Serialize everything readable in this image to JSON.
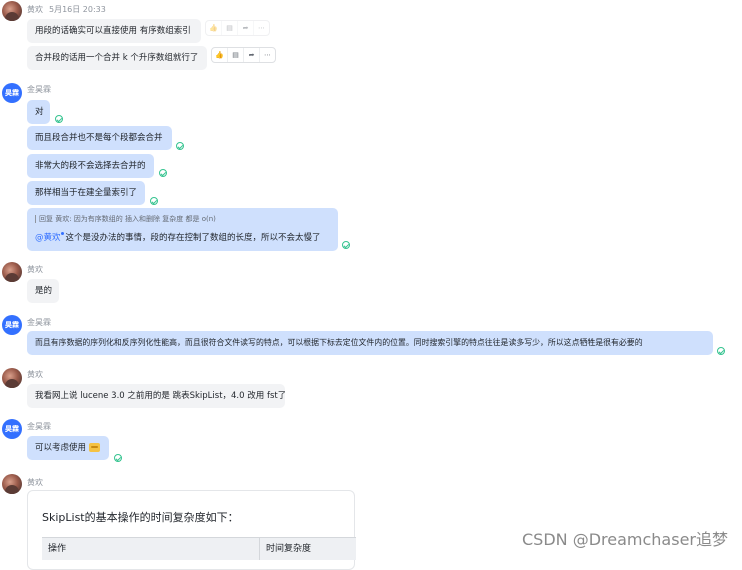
{
  "messages": {
    "m1": {
      "sender": "黄欢",
      "time": "5月16日 20:33",
      "bubbles": [
        "用段的话确实可以直接使用 有序数组索引",
        "合并段的话用一个合并 k 个升序数组就行了"
      ]
    },
    "m2": {
      "sender": "金昊霖",
      "avatar_text": "昊霖",
      "bubbles": [
        "对",
        "而且段合并也不是每个段都会合并",
        "非常大的段不会选择去合并的",
        "那样相当于在建全量索引了"
      ],
      "quote": {
        "text": "回复 黄欢: 因为有序数组的 插入和删除 复杂度 都是 o(n)",
        "mention": "@黄欢",
        "reply": "这个是没办法的事情，段的存在控制了数组的长度，所以不会太慢了"
      }
    },
    "m3": {
      "sender": "黄欢",
      "bubble": "是的"
    },
    "m4": {
      "sender": "金昊霖",
      "avatar_text": "昊霖",
      "bubble": "而且有序数据的序列化和反序列化性能高，而且很符合文件读写的特点，可以根据下标去定位文件内的位置。同时搜索引擎的特点往往是读多写少，所以这点牺牲是很有必要的"
    },
    "m5": {
      "sender": "黄欢",
      "bubble": "我看网上说 lucene 3.0 之前用的是 跳表SkipList，4.0 改用 fst了"
    },
    "m6": {
      "sender": "金昊霖",
      "avatar_text": "昊霖",
      "bubble": "可以考虑使用"
    },
    "m7": {
      "sender": "黄欢",
      "card": {
        "title": "SkipList的基本操作的时间复杂度如下：",
        "columns": [
          "操作",
          "时间复杂度"
        ]
      }
    }
  },
  "toolbar_icons": [
    "thumbs-up-icon",
    "comment-icon",
    "forward-icon",
    "more-icon"
  ],
  "watermark": "CSDN @Dreamchaser追梦",
  "colors": {
    "bubble_gray": "#f2f3f5",
    "bubble_blue": "#cfe0fd",
    "avatar_blue": "#3370ff",
    "read_check": "#34c38f",
    "mention": "#3370ff"
  }
}
